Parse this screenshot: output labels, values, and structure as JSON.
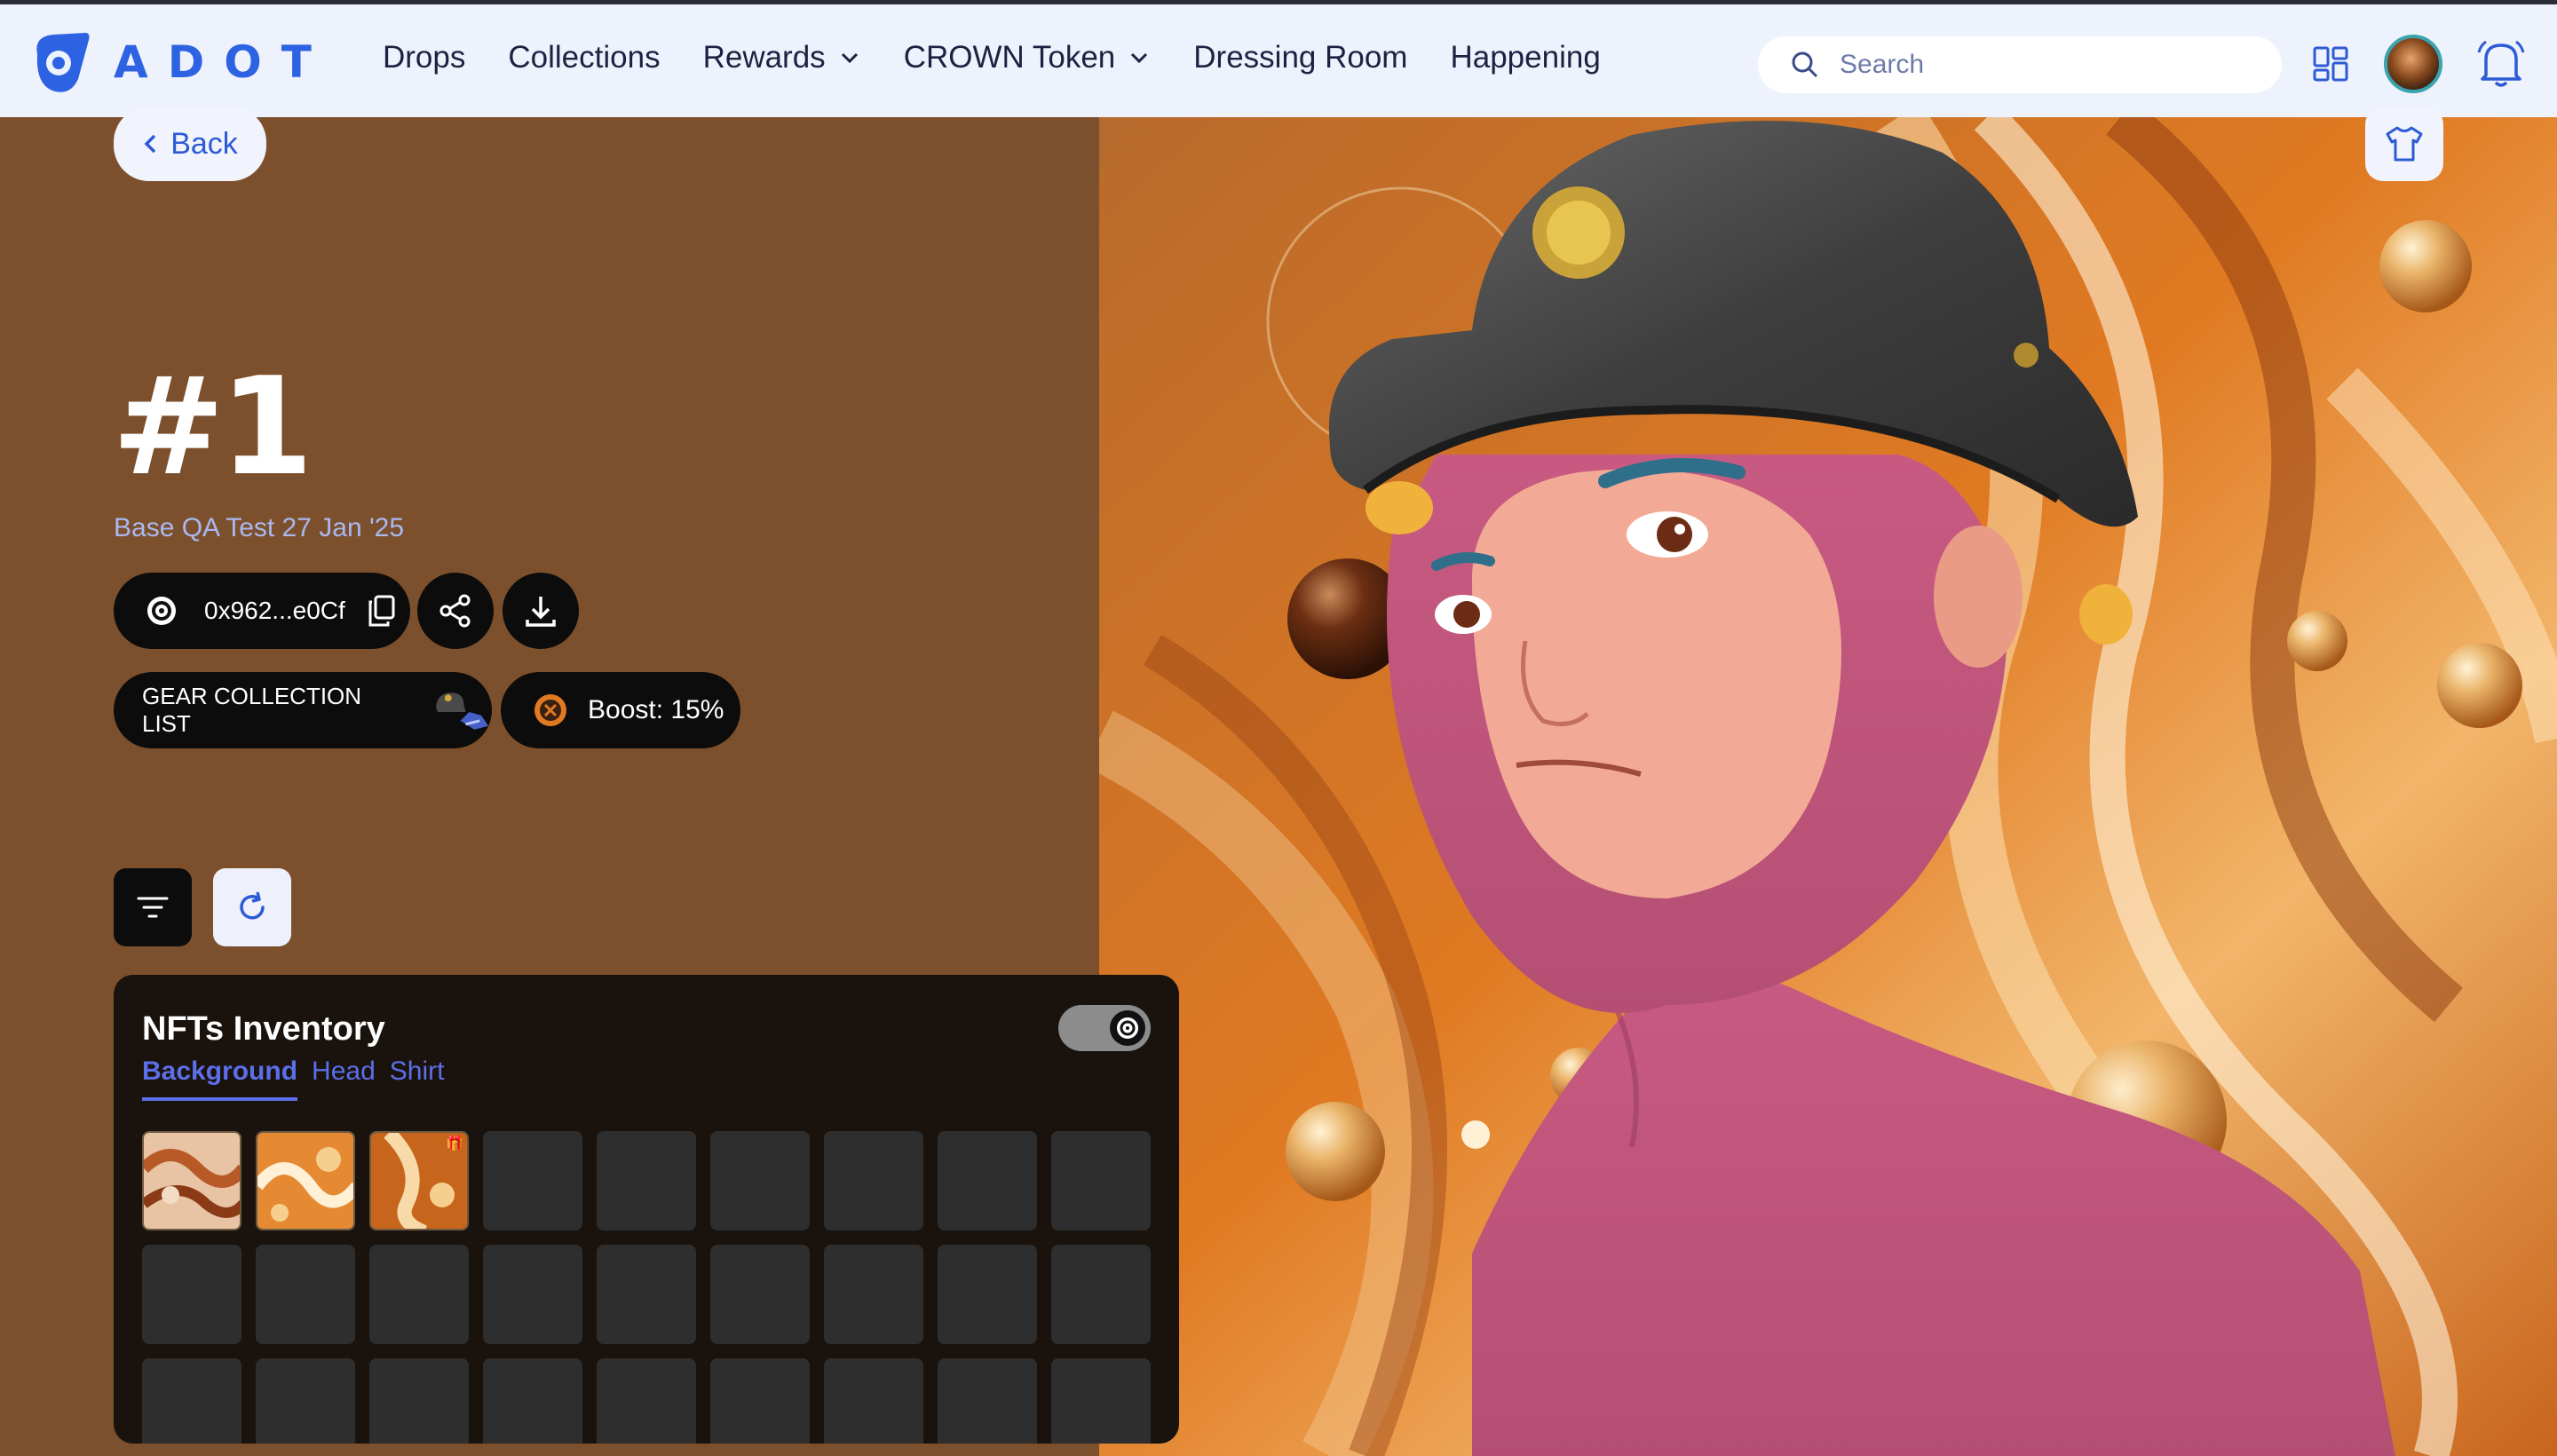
{
  "app": {
    "brand": "ADOT",
    "nav": [
      {
        "label": "Drops",
        "has_dropdown": false
      },
      {
        "label": "Collections",
        "has_dropdown": false
      },
      {
        "label": "Rewards",
        "has_dropdown": true
      },
      {
        "label": "CROWN Token",
        "has_dropdown": true
      },
      {
        "label": "Dressing Room",
        "has_dropdown": false
      },
      {
        "label": "Happening",
        "has_dropdown": false
      }
    ],
    "search": {
      "placeholder": "Search",
      "value": ""
    },
    "icons": [
      "dashboard-grid-icon",
      "bell-icon",
      "search-icon"
    ]
  },
  "detail": {
    "back_label": "Back",
    "title": "#1",
    "subtitle": "Base QA Test 27 Jan '25",
    "address": "0x962...e0Cf",
    "gear_label": "GEAR COLLECTION LIST",
    "boost_label": "Boost: 15%"
  },
  "inventory": {
    "title": "NFTs Inventory",
    "toggle_on": true,
    "tabs": [
      {
        "label": "Background",
        "active": true
      },
      {
        "label": "Head",
        "active": false
      },
      {
        "label": "Shirt",
        "active": false
      }
    ],
    "filled_slots": 3,
    "total_visible_slots": 27
  },
  "colors": {
    "accent": "#2d63e2",
    "panel_bg": "#7c502c",
    "nav_bg": "#eef2fc",
    "tab": "#5b6fe8"
  }
}
